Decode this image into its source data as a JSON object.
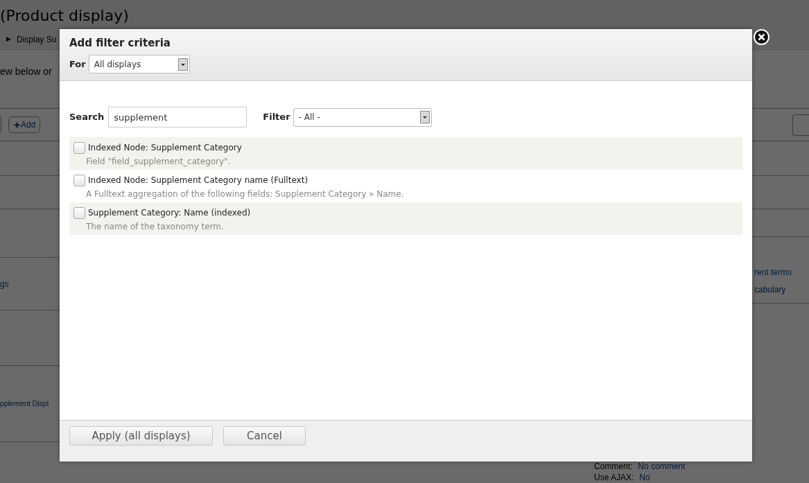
{
  "page": {
    "title": "(Product display)",
    "breadcrumb": {
      "separator": "▶",
      "text": "Display Su"
    },
    "intro": "ew below or",
    "add_button": "Add",
    "left_links": [
      "gs",
      "pplement Displ"
    ],
    "right_links": [
      "rent terms",
      "cabulary"
    ],
    "settings": [
      {
        "label": "Comment:",
        "value": "No comment"
      },
      {
        "label": "Use AJAX:",
        "value": "No"
      }
    ]
  },
  "dialog": {
    "title": "Add filter criteria",
    "for": {
      "label": "For",
      "value": "All displays"
    },
    "search": {
      "label": "Search",
      "value": "supplement"
    },
    "filter": {
      "label": "Filter",
      "value": "- All -"
    },
    "options": [
      {
        "title": "Indexed Node: Supplement Category",
        "description": "Field \"field_supplement_category\".",
        "checked": false
      },
      {
        "title": "Indexed Node: Supplement Category name (Fulltext)",
        "description": "A Fulltext aggregation of the following fields: Supplement Category » Name.",
        "checked": false
      },
      {
        "title": "Supplement Category: Name (indexed)",
        "description": "The name of the taxonomy term.",
        "checked": false
      }
    ],
    "buttons": [
      "Apply (all displays)",
      "Cancel"
    ]
  }
}
